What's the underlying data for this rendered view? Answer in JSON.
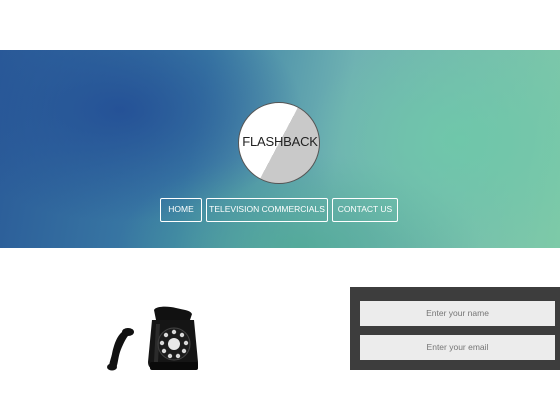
{
  "header": {
    "logo_text": "FLASHBACK"
  },
  "nav": {
    "items": [
      {
        "label": "HOME"
      },
      {
        "label": "TELEVISION COMMERCIALS"
      },
      {
        "label": "CONTACT US"
      }
    ]
  },
  "contact_form": {
    "name_placeholder": "Enter your name",
    "email_placeholder": "Enter your email"
  },
  "colors": {
    "hero_blue": "#2a5a98",
    "hero_green": "#7dcaa8",
    "form_panel": "#3d3d3d",
    "field_bg": "#ececec"
  },
  "icons": {
    "hero_image": "rotary-telephone-icon"
  }
}
